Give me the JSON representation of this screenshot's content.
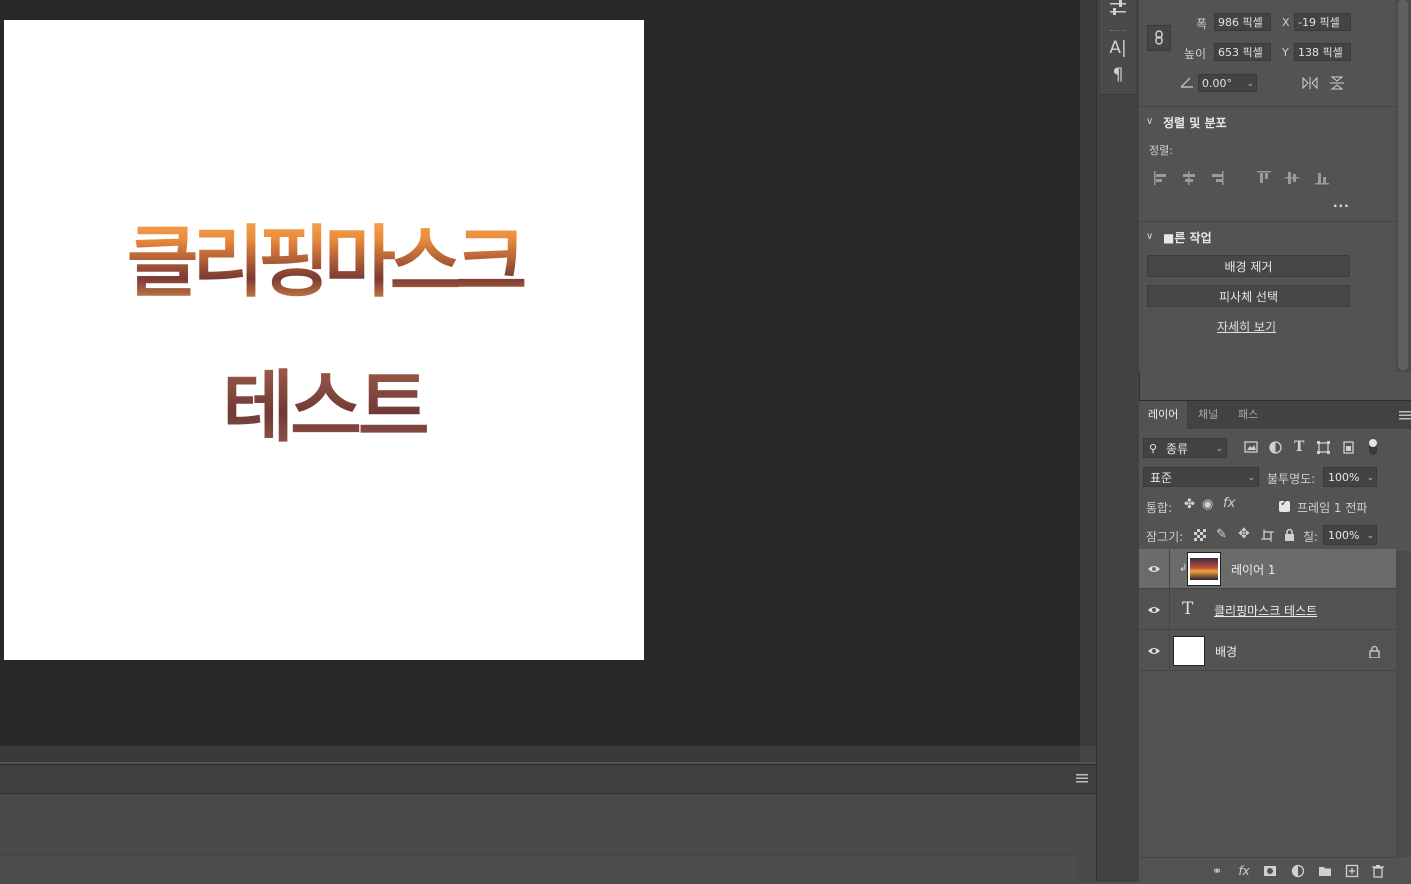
{
  "document": {
    "line1": "클리핑마스크",
    "line2": "테스트"
  },
  "properties": {
    "width_label": "폭",
    "width_value": "986 픽셀",
    "height_label": "높이",
    "height_value": "653 픽셀",
    "x_label": "X",
    "x_value": "-19 픽셀",
    "y_label": "Y",
    "y_value": "138 픽셀",
    "angle_value": "0.00°",
    "align_section_title": "정렬 및 분포",
    "align_label": "정렬:",
    "more_label": "...",
    "quick_section_title": "■른 작업",
    "remove_bg_button": "배경 제거",
    "select_subject_button": "피사체 선택",
    "learn_more_link": "자세히 보기"
  },
  "layers_panel": {
    "tabs": [
      "레이어",
      "채널",
      "패스"
    ],
    "filter_kind": "종류",
    "blend_mode": "표준",
    "opacity_label": "불투명도:",
    "opacity_value": "100%",
    "unify_label": "통합:",
    "propagate_label": "프레임 1 전파",
    "lock_label": "잠그기:",
    "fill_label": "칠:",
    "fill_value": "100%",
    "layers": [
      {
        "name": "레이어 1",
        "selected": true,
        "kind": "clipped-image"
      },
      {
        "name": "클리핑마스크 테스트",
        "selected": false,
        "kind": "text"
      },
      {
        "name": "배경",
        "selected": false,
        "kind": "background",
        "locked": true
      }
    ]
  },
  "colors": {
    "canvas_bg": "#282828",
    "panel_bg": "#535353",
    "selected_row": "#6b6b6b",
    "text_gradient_top": "#f7c068",
    "text_gradient_mid": "#7b3a34"
  }
}
